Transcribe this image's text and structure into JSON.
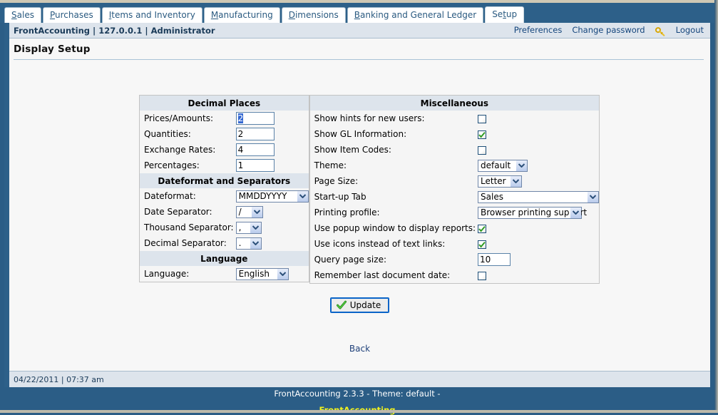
{
  "tabs": [
    {
      "label": "Sales",
      "accel": "S",
      "active": false
    },
    {
      "label": "Purchases",
      "accel": "P",
      "active": false
    },
    {
      "label": "Items and Inventory",
      "accel": "I",
      "active": false
    },
    {
      "label": "Manufacturing",
      "accel": "M",
      "active": false
    },
    {
      "label": "Dimensions",
      "accel": "D",
      "active": false
    },
    {
      "label": "Banking and General Ledger",
      "accel": "B",
      "active": false
    },
    {
      "label": "Setup",
      "accel": "t",
      "active": true
    }
  ],
  "userbar": {
    "info": "FrontAccounting | 127.0.0.1 | Administrator",
    "preferences": "Preferences",
    "change_password": "Change password",
    "logout": "Logout"
  },
  "page": {
    "title": "Display Setup",
    "back_label": "Back",
    "update_label": "Update"
  },
  "decimal_places": {
    "heading": "Decimal Places",
    "rows": [
      {
        "label": "Prices/Amounts:",
        "value": "2"
      },
      {
        "label": "Quantities:",
        "value": "2"
      },
      {
        "label": "Exchange Rates:",
        "value": "4"
      },
      {
        "label": "Percentages:",
        "value": "1"
      }
    ]
  },
  "dateformat": {
    "heading": "Dateformat and Separators",
    "rows": [
      {
        "label": "Dateformat:",
        "value": "MMDDYYYY"
      },
      {
        "label": "Date Separator:",
        "value": "/"
      },
      {
        "label": "Thousand Separator:",
        "value": ","
      },
      {
        "label": "Decimal Separator:",
        "value": "."
      }
    ]
  },
  "language": {
    "heading": "Language",
    "rows": [
      {
        "label": "Language:",
        "value": "English"
      }
    ]
  },
  "miscellaneous": {
    "heading": "Miscellaneous",
    "rows": [
      {
        "label": "Show hints for new users:",
        "type": "checkbox",
        "checked": false
      },
      {
        "label": "Show GL Information:",
        "type": "checkbox",
        "checked": true
      },
      {
        "label": "Show Item Codes:",
        "type": "checkbox",
        "checked": false
      },
      {
        "label": "Theme:",
        "type": "select",
        "value": "default"
      },
      {
        "label": "Page Size:",
        "type": "select",
        "value": "Letter"
      },
      {
        "label": "Start-up Tab",
        "type": "select",
        "value": "Sales"
      },
      {
        "label": "Printing profile:",
        "type": "select",
        "value": "Browser printing support"
      },
      {
        "label": "Use popup window to display reports:",
        "type": "checkbox",
        "checked": true
      },
      {
        "label": "Use icons instead of text links:",
        "type": "checkbox",
        "checked": true
      },
      {
        "label": "Query page size:",
        "type": "text",
        "value": "10"
      },
      {
        "label": "Remember last document date:",
        "type": "checkbox",
        "checked": false
      }
    ]
  },
  "statusbar": {
    "datetime": "04/22/2011 | 07:37 am"
  },
  "footer": {
    "line1": "FrontAccounting 2.3.3 - Theme: default -",
    "link": "FrontAccounting"
  },
  "colors": {
    "chrome_blue": "#2d6089",
    "band_blue": "#dde4ec",
    "link_blue": "#14457c",
    "footer_link_yellow": "#f2f21c",
    "check_green": "#2f9a23"
  }
}
